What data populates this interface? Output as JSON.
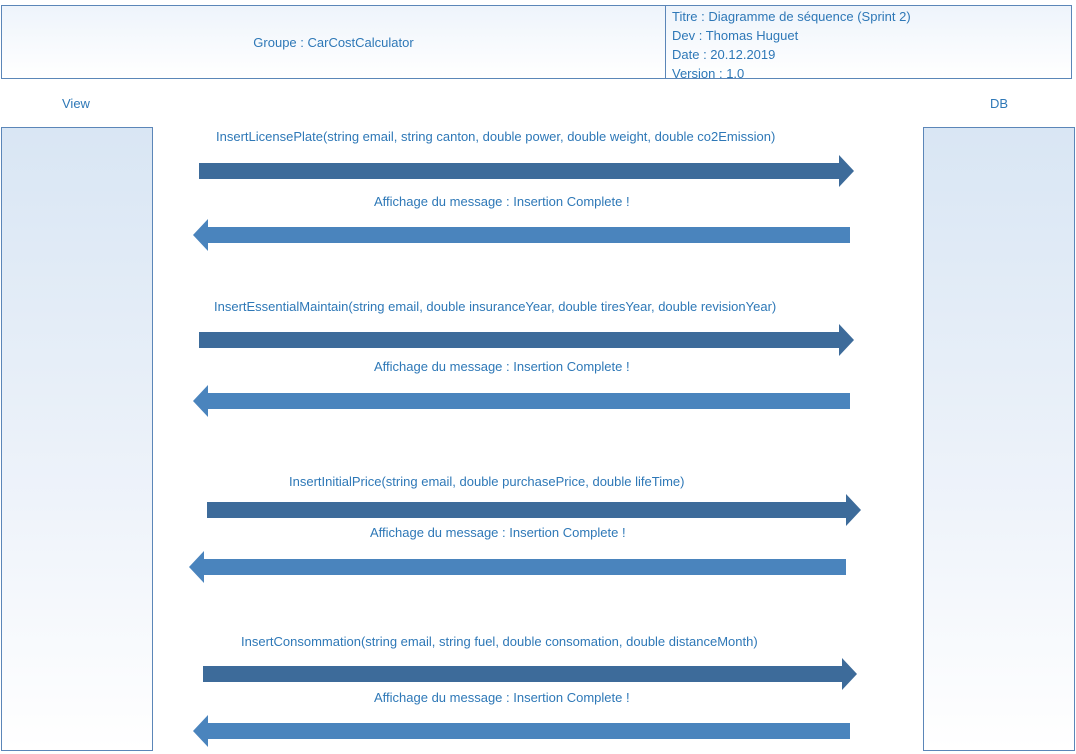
{
  "header": {
    "group": "Groupe : CarCostCalculator",
    "title": "Titre : Diagramme de séquence (Sprint 2)",
    "dev": "Dev : Thomas Huguet",
    "date": "Date : 20.12.2019",
    "version": "Version : 1.0"
  },
  "actors": {
    "left": "View",
    "right": "DB"
  },
  "messages": [
    {
      "call": "InsertLicensePlate(string email, string canton, double power, double weight, double co2Emission)",
      "response": "Affichage du message : Insertion Complete !"
    },
    {
      "call": "InsertEssentialMaintain(string email, double insuranceYear, double tiresYear, double revisionYear)",
      "response": "Affichage du message : Insertion Complete !"
    },
    {
      "call": "InsertInitialPrice(string email, double purchasePrice, double lifeTime)",
      "response": "Affichage du message : Insertion Complete !"
    },
    {
      "call": "InsertConsommation(string email, string fuel, double consomation, double distanceMonth)",
      "response": "Affichage du message : Insertion Complete !"
    }
  ],
  "colors": {
    "call_arrow": "#3d6b9a",
    "response_arrow": "#4a84bd",
    "text": "#2e78b7",
    "border": "#5b86b8"
  }
}
